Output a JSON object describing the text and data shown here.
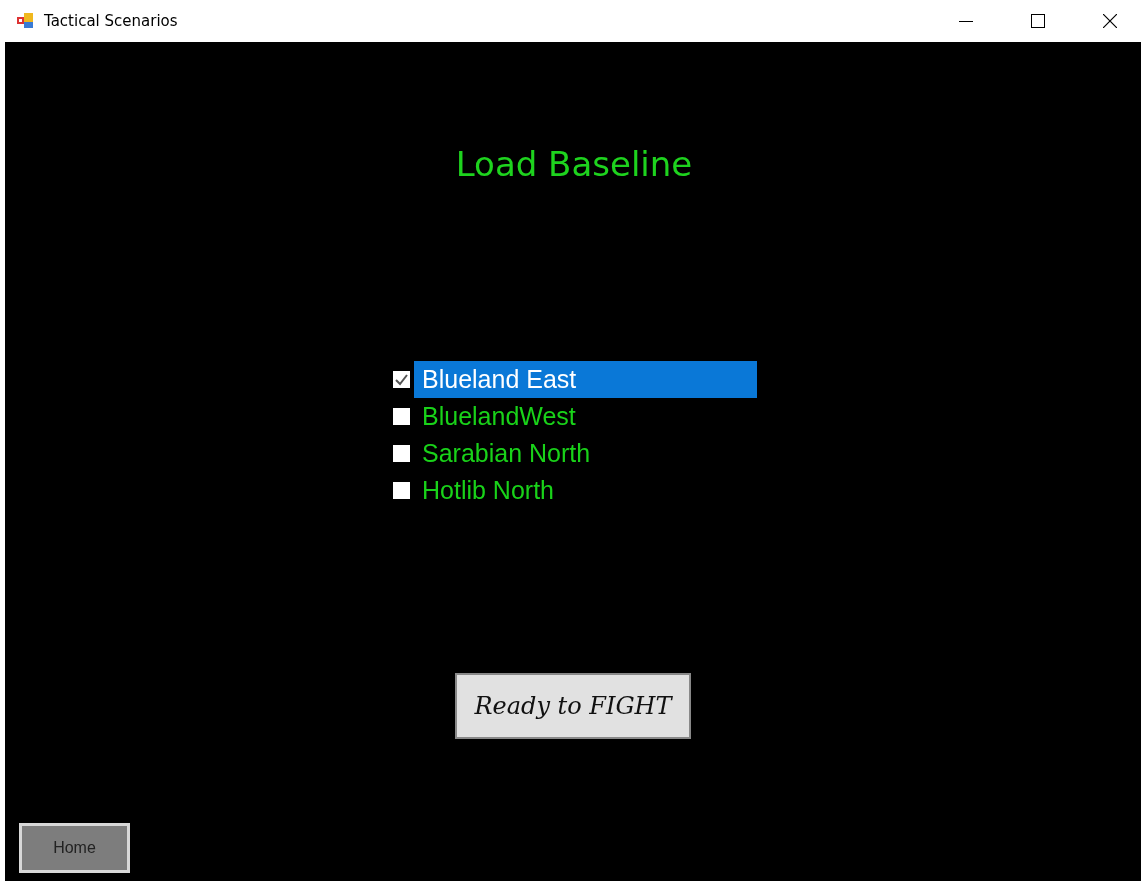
{
  "window": {
    "title": "Tactical Scenarios"
  },
  "heading": "Load Baseline",
  "scenarios": [
    {
      "label": "Blueland East",
      "checked": true,
      "selected": true
    },
    {
      "label": "BluelandWest",
      "checked": false,
      "selected": false
    },
    {
      "label": "Sarabian North",
      "checked": false,
      "selected": false
    },
    {
      "label": "Hotlib North",
      "checked": false,
      "selected": false
    }
  ],
  "buttons": [
    {
      "label": "Ready to FIGHT",
      "kind": "primary"
    },
    {
      "label": "Home",
      "kind": "nav"
    }
  ]
}
